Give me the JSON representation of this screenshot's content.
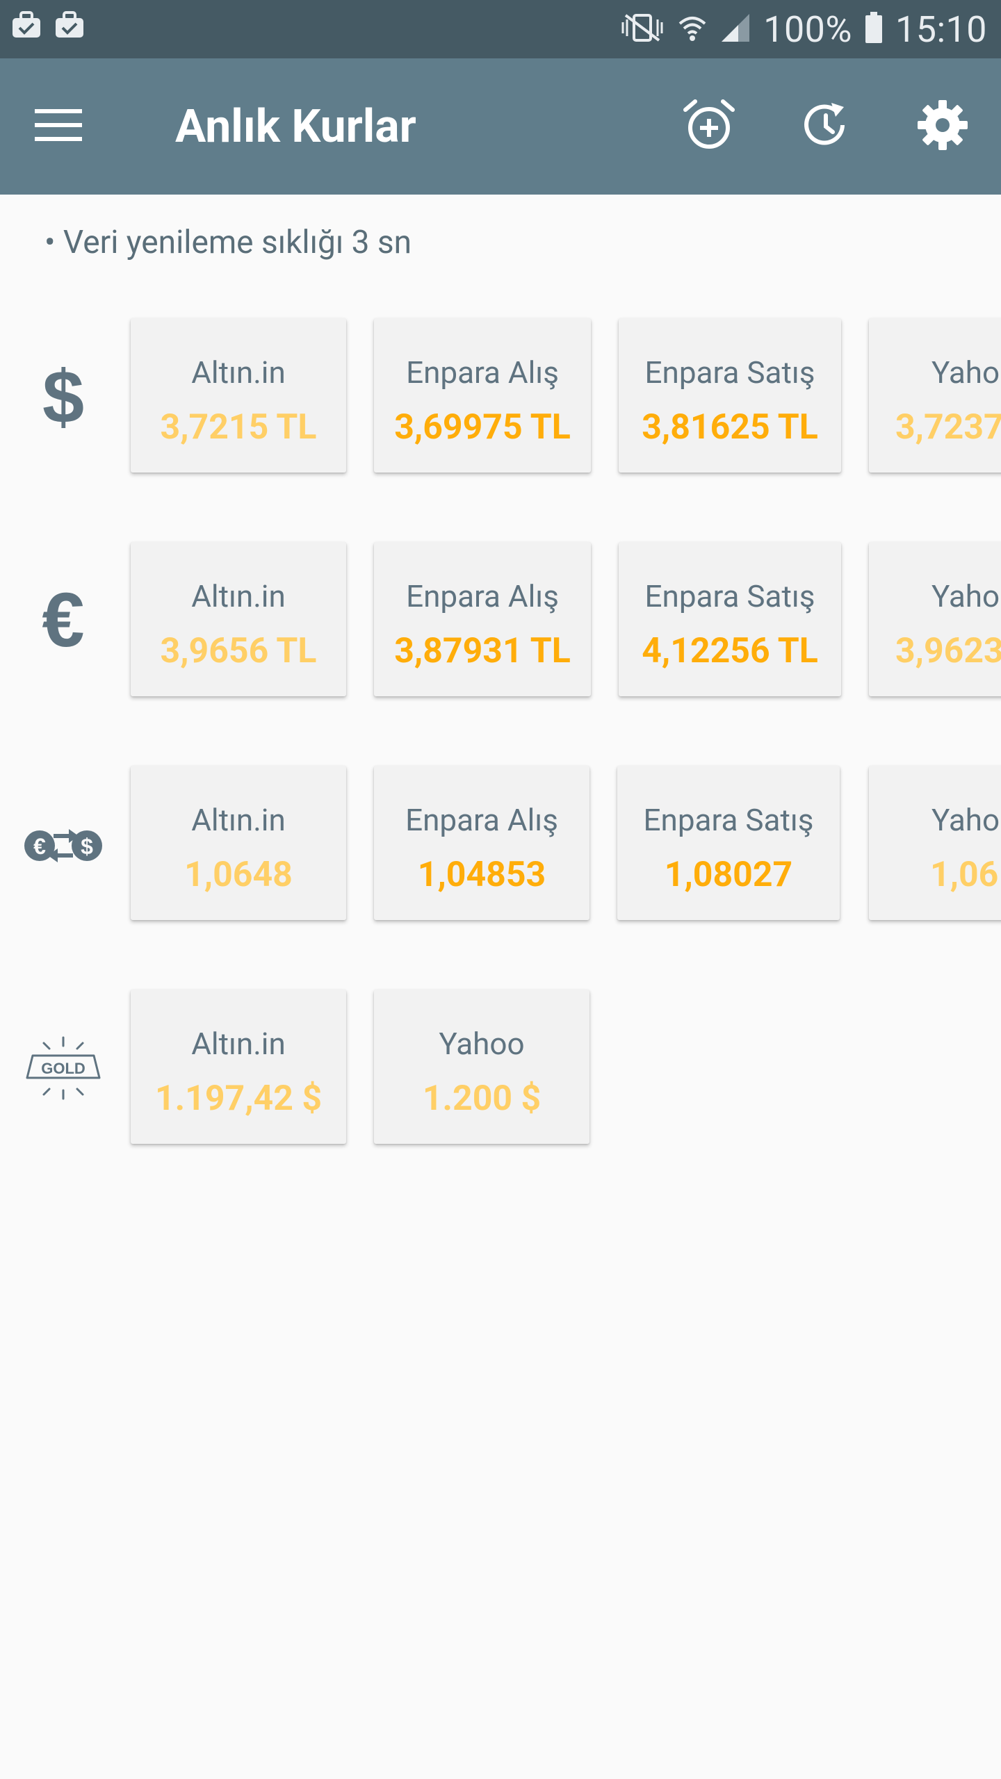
{
  "status_bar": {
    "battery_percent": "100%",
    "time": "15:10",
    "left_icons": [
      "briefcase-check-icon",
      "briefcase-check-icon"
    ],
    "right_icons": [
      "vibrate-mute-icon",
      "wifi-icon",
      "signal-icon",
      "battery-icon"
    ]
  },
  "app_bar": {
    "title": "Anlık Kurlar",
    "menu_icon": "menu-icon",
    "actions": [
      "alarm-add-icon",
      "history-icon",
      "settings-icon"
    ]
  },
  "notice": "• Veri yenileme sıklığı 3 sn",
  "colors": {
    "status_bar": "#455a64",
    "app_bar": "#607d8b",
    "value_light": "#ffcf66",
    "value_strong": "#ffad0a",
    "label": "#5f7380"
  },
  "rows": [
    {
      "icon": "dollar-icon",
      "cards": [
        {
          "source": "Altın.in",
          "value": "3,7215 TL"
        },
        {
          "source": "Enpara Alış",
          "value": "3,69975 TL"
        },
        {
          "source": "Enpara Satış",
          "value": "3,81625 TL"
        },
        {
          "source": "Yaho",
          "value": "3,7237"
        }
      ]
    },
    {
      "icon": "euro-icon",
      "cards": [
        {
          "source": "Altın.in",
          "value": "3,9656 TL"
        },
        {
          "source": "Enpara Alış",
          "value": "3,87931 TL"
        },
        {
          "source": "Enpara Satış",
          "value": "4,12256 TL"
        },
        {
          "source": "Yaho",
          "value": "3,9623"
        }
      ]
    },
    {
      "icon": "euro-dollar-exchange-icon",
      "cards": [
        {
          "source": "Altın.in",
          "value": "1,0648"
        },
        {
          "source": "Enpara Alış",
          "value": "1,04853"
        },
        {
          "source": "Enpara Satış",
          "value": "1,08027"
        },
        {
          "source": "Yaho",
          "value": "1,06"
        }
      ]
    },
    {
      "icon": "gold-bar-icon",
      "icon_text": "GOLD",
      "cards": [
        {
          "source": "Altın.in",
          "value": "1.197,42 $"
        },
        {
          "source": "Yahoo",
          "value": "1.200 $"
        }
      ]
    }
  ]
}
